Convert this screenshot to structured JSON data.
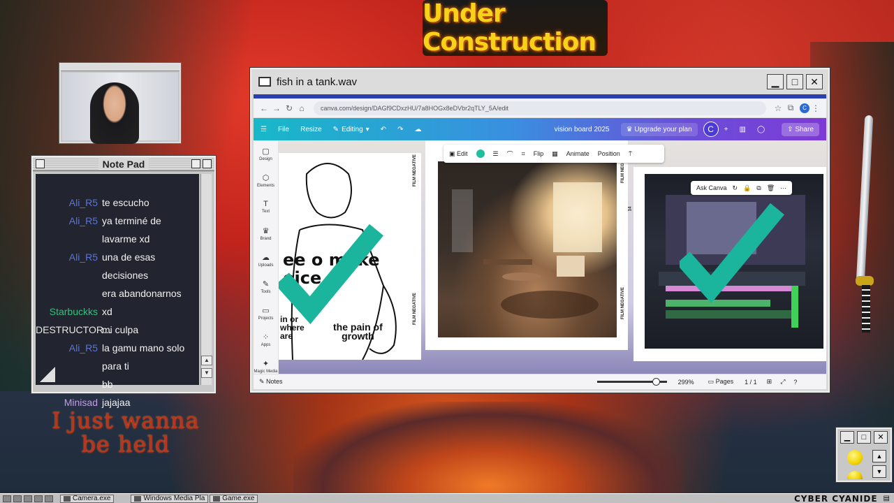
{
  "banner": {
    "text": "Under Construction"
  },
  "notepad": {
    "title": "Note Pad",
    "messages": [
      {
        "user": "Ali_R5",
        "text": "te escucho",
        "color": "#5b74d6"
      },
      {
        "user": "Ali_R5",
        "text": "ya terminé de lavarme xd",
        "color": "#5b74d6"
      },
      {
        "user": "Ali_R5",
        "text": "una de esas decisiones",
        "color": "#5b74d6"
      },
      {
        "user": "",
        "text": "era abandonarnos",
        "color": "#5b74d6"
      },
      {
        "user": "Starbuckks",
        "text": "xd",
        "color": "#33c07a"
      },
      {
        "user": "DESTRUCTOR...",
        "text": "mi culpa",
        "color": "#e8e8e8"
      },
      {
        "user": "Ali_R5",
        "text": "la gamu mano solo para ti",
        "color": "#5b74d6"
      },
      {
        "user": "",
        "text": "bb",
        "color": "#5b74d6"
      },
      {
        "user": "Minisad",
        "text": "jajajaa",
        "color": "#c39be8"
      }
    ]
  },
  "overlay_text": {
    "line1": "I just wanna",
    "line2": "be held"
  },
  "window": {
    "title": "fish in a tank.wav",
    "minimize": "▁",
    "maximize": "□",
    "close": "✕"
  },
  "browser": {
    "url": "canva.com/design/DAGf9CDxzHU/7a8HOGx8eDVbr2qTLY_5A/edit"
  },
  "canva": {
    "menu": "☰",
    "file": "File",
    "resize": "Resize",
    "editing": "Editing",
    "doc_title": "vision board 2025",
    "upgrade": "Upgrade your plan",
    "avatar": "C",
    "share": "Share",
    "side_nav": [
      "Design",
      "Elements",
      "Text",
      "Brand",
      "Uploads",
      "Tools",
      "Projects",
      "Apps",
      "Magic Media"
    ],
    "context_toolbar": {
      "edit": "Edit",
      "flip": "Flip",
      "animate": "Animate",
      "position": "Position"
    },
    "ask_canva": "Ask Canva",
    "sketch_headline_1": "ee   o make",
    "sketch_headline_2": "  oice",
    "sketch_sub1": "in or\nwhere\nare",
    "sketch_sub2": "the pain of\ngrowth",
    "film_negative": "FILM NEGATIVE",
    "film_number": "14",
    "notes": "Notes",
    "zoom": "299%",
    "pages": "Pages",
    "page_count": "1 / 1"
  },
  "taskbar": {
    "items": [
      "Camera.exe",
      "Windows Media Pla",
      "Game.exe"
    ],
    "right_text": "CYBER CYANIDE"
  },
  "colors": {
    "check": "#1ab59c",
    "canva_accent": "#7d3ad6"
  }
}
